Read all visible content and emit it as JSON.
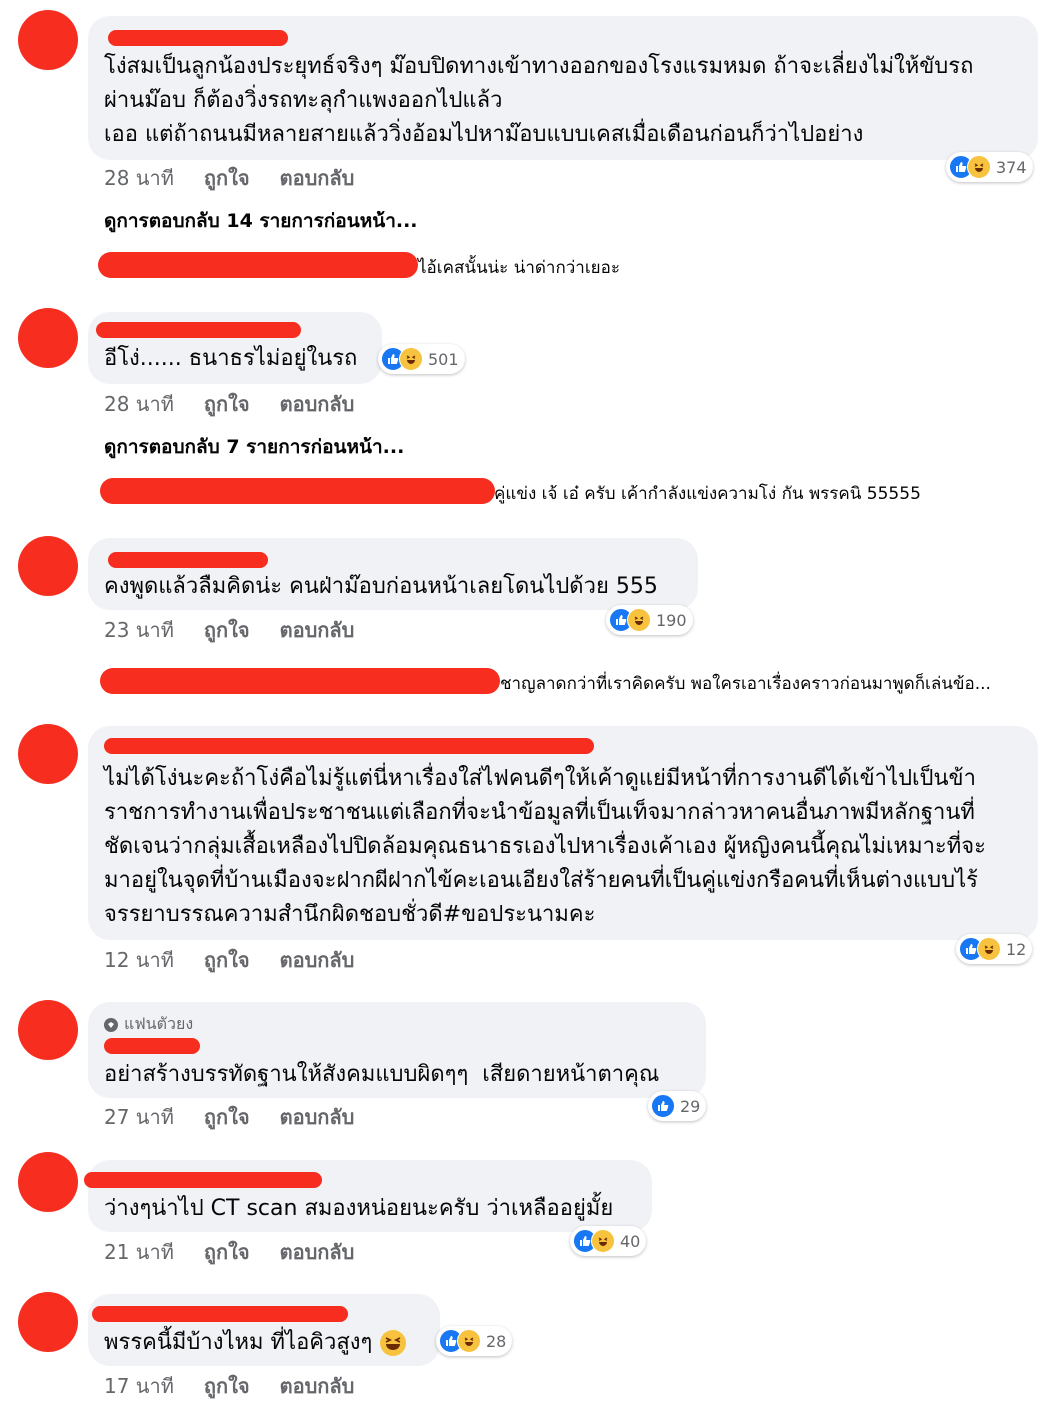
{
  "actions": {
    "like_label": "ถูกใจ",
    "reply_label": "ตอบกลับ"
  },
  "comments": [
    {
      "lines": [
        "โง่สมเป็นลูกน้องประยุทธ์จริงๆ ม๊อบปิดทางเข้าทางออกของโรงแรมหมด ถ้าจะเลี่ยงไม่ให้ขับรถ",
        "ผ่านม๊อบ ก็ต้องวิ่งรถทะลุกำแพงออกไปแล้ว",
        "เออ แต่ถ้าถนนมีหลายสายแล้ววิ่งอ้อมไปหาม๊อบแบบเคสเมื่อเดือนก่อนก็ว่าไปอย่าง"
      ],
      "time": "28 นาที",
      "reactions": "374",
      "view_more": "ดูการตอบกลับ 14 รายการก่อนหน้า...",
      "reply_preview": "ไอ้เคสนั้นน่ะ น่าด่ากว่าเยอะ"
    },
    {
      "lines": [
        "อีโง่...... ธนาธรไม่อยู่ในรถ"
      ],
      "time": "28 นาที",
      "reactions": "501",
      "view_more": "ดูการตอบกลับ 7 รายการก่อนหน้า...",
      "reply_preview": "คู่แข่ง เจ้ เอ๋ ครับ เค้ากำลังแข่งความโง่ กัน พรรคนิ 55555"
    },
    {
      "lines": [
        "คงพูดแล้วลืมคิดน่ะ คนฝ่าม๊อบก่อนหน้าเลยโดนไปด้วย 555"
      ],
      "time": "23 นาที",
      "reactions": "190",
      "reply_preview": "ชาญลาดกว่าที่เราคิดครับ พอใครเอาเรื่องคราวก่อนมาพูดก็เล่นข้อ..."
    },
    {
      "lines": [
        "ไม่ได้โง่นะคะถ้าโง่คือไม่รู้แต่นี่หาเรื่องใส่ไฟคนดีๆให้เค้าดูแย่มีหน้าที่การงานดีได้เข้าไปเป็นข้า",
        "ราชการทำงานเพื่อประชาชนแต่เลือกที่จะนำข้อมูลที่เป็นเท็จมากล่าวหาคนอื่นภาพมีหลักฐานที่",
        "ชัดเจนว่ากลุ่มเสื้อเหลืองไปปิดล้อมคุณธนาธรเองไปหาเรื่องเค้าเอง ผู้หญิงคนนี้คุณไม่เหมาะที่จะ",
        "มาอยู่ในจุดที่บ้านเมืองจะฝากผีฝากไข้คะเอนเอียงใส่ร้ายคนที่เป็นคู่แข่งกรือคนที่เห็นต่างแบบไร้",
        "จรรยาบรรณความสำนึกผิดชอบชั่วดี#ขอประนามคะ"
      ],
      "time": "12 นาที",
      "reactions": "12"
    },
    {
      "badge": "แฟนตัวยง",
      "lines": [
        "อย่าสร้างบรรทัดฐานให้สังคมแบบผิดๆๆ  เสียดายหน้าตาคุณ"
      ],
      "time": "27 นาที",
      "reactions": "29"
    },
    {
      "lines": [
        "ว่างๆน่าไป CT scan สมองหน่อยนะครับ ว่าเหลืออยู่มั้ย"
      ],
      "time": "21 นาที",
      "reactions": "40"
    },
    {
      "lines": [
        "พรรคนี้มีบ้างไหม ที่ไอคิวสูงๆ"
      ],
      "time": "17 นาที",
      "reactions": "28"
    }
  ]
}
